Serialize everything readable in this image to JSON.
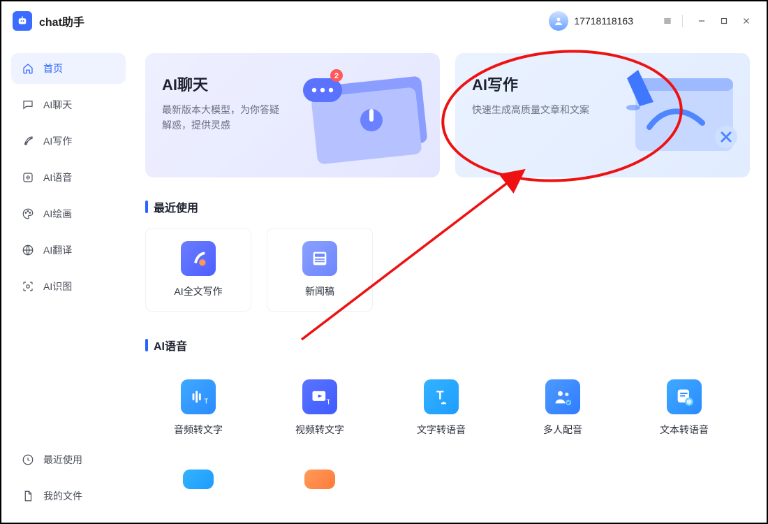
{
  "app": {
    "title": "chat助手"
  },
  "user": {
    "name": "17718118163"
  },
  "sidebar": {
    "items": [
      {
        "label": "首页"
      },
      {
        "label": "AI聊天"
      },
      {
        "label": "AI写作"
      },
      {
        "label": "AI语音"
      },
      {
        "label": "AI绘画"
      },
      {
        "label": "AI翻译"
      },
      {
        "label": "AI识图"
      }
    ],
    "footer": [
      {
        "label": "最近使用"
      },
      {
        "label": "我的文件"
      }
    ]
  },
  "hero": {
    "chat": {
      "title": "AI聊天",
      "desc": "最新版本大模型，为你答疑解惑，提供灵感"
    },
    "write": {
      "title": "AI写作",
      "desc": "快速生成高质量文章和文案"
    }
  },
  "sections": {
    "recent": {
      "title": "最近使用",
      "items": [
        {
          "label": "AI全文写作"
        },
        {
          "label": "新闻稿"
        }
      ]
    },
    "voice": {
      "title": "AI语音",
      "items": [
        {
          "label": "音频转文字"
        },
        {
          "label": "视频转文字"
        },
        {
          "label": "文字转语音"
        },
        {
          "label": "多人配音"
        },
        {
          "label": "文本转语音"
        }
      ]
    }
  }
}
